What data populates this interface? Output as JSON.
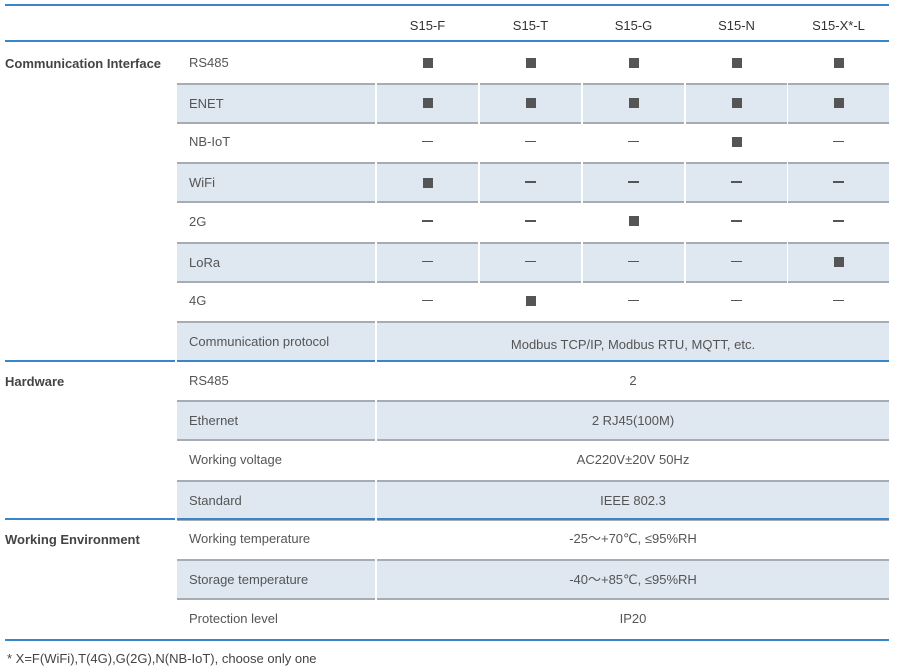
{
  "header": {
    "columns": [
      "S15-F",
      "S15-T",
      "S15-G",
      "S15-N",
      "S15-X*-L"
    ]
  },
  "legend": {
    "supported_icon": "filled-square-icon",
    "not_supported_icon": "dash-icon"
  },
  "colors": {
    "accent_line": "#3a86c8",
    "shaded_row": "#dfe7f1",
    "mark": "#555555"
  },
  "groups": [
    {
      "label": "Communication Interface",
      "rows": [
        {
          "label": "RS485",
          "values": [
            "yes",
            "yes",
            "yes",
            "yes",
            "yes"
          ]
        },
        {
          "label": "ENET",
          "values": [
            "yes",
            "yes",
            "yes",
            "yes",
            "yes"
          ]
        },
        {
          "label": "NB-IoT",
          "values": [
            "no",
            "no",
            "no",
            "yes",
            "no"
          ]
        },
        {
          "label": "WiFi",
          "values": [
            "yes",
            "no",
            "no",
            "no",
            "no"
          ]
        },
        {
          "label": "2G",
          "values": [
            "no",
            "no",
            "yes",
            "no",
            "no"
          ]
        },
        {
          "label": "LoRa",
          "values": [
            "no",
            "no",
            "no",
            "no",
            "yes"
          ]
        },
        {
          "label": "4G",
          "values": [
            "no",
            "yes",
            "no",
            "no",
            "no"
          ]
        },
        {
          "label": "Communication protocol",
          "merged": "Modbus TCP/IP, Modbus RTU, MQTT, etc."
        }
      ]
    },
    {
      "label": "Hardware",
      "rows": [
        {
          "label": "RS485",
          "merged": "2"
        },
        {
          "label": "Ethernet",
          "merged": "2 RJ45(100M)"
        },
        {
          "label": "Working voltage",
          "merged": "AC220V±20V 50Hz"
        },
        {
          "label": "Standard",
          "merged": "IEEE 802.3"
        }
      ]
    },
    {
      "label": "Working Environment",
      "rows": [
        {
          "label": "Working temperature",
          "merged": "-25～+70℃, ≤95%RH"
        },
        {
          "label": "Storage temperature",
          "merged": "-40～+85℃, ≤95%RH"
        },
        {
          "label": "Protection level",
          "merged": "IP20"
        }
      ]
    }
  ],
  "footnote": "* X=F(WiFi),T(4G),G(2G),N(NB-IoT), choose only one"
}
